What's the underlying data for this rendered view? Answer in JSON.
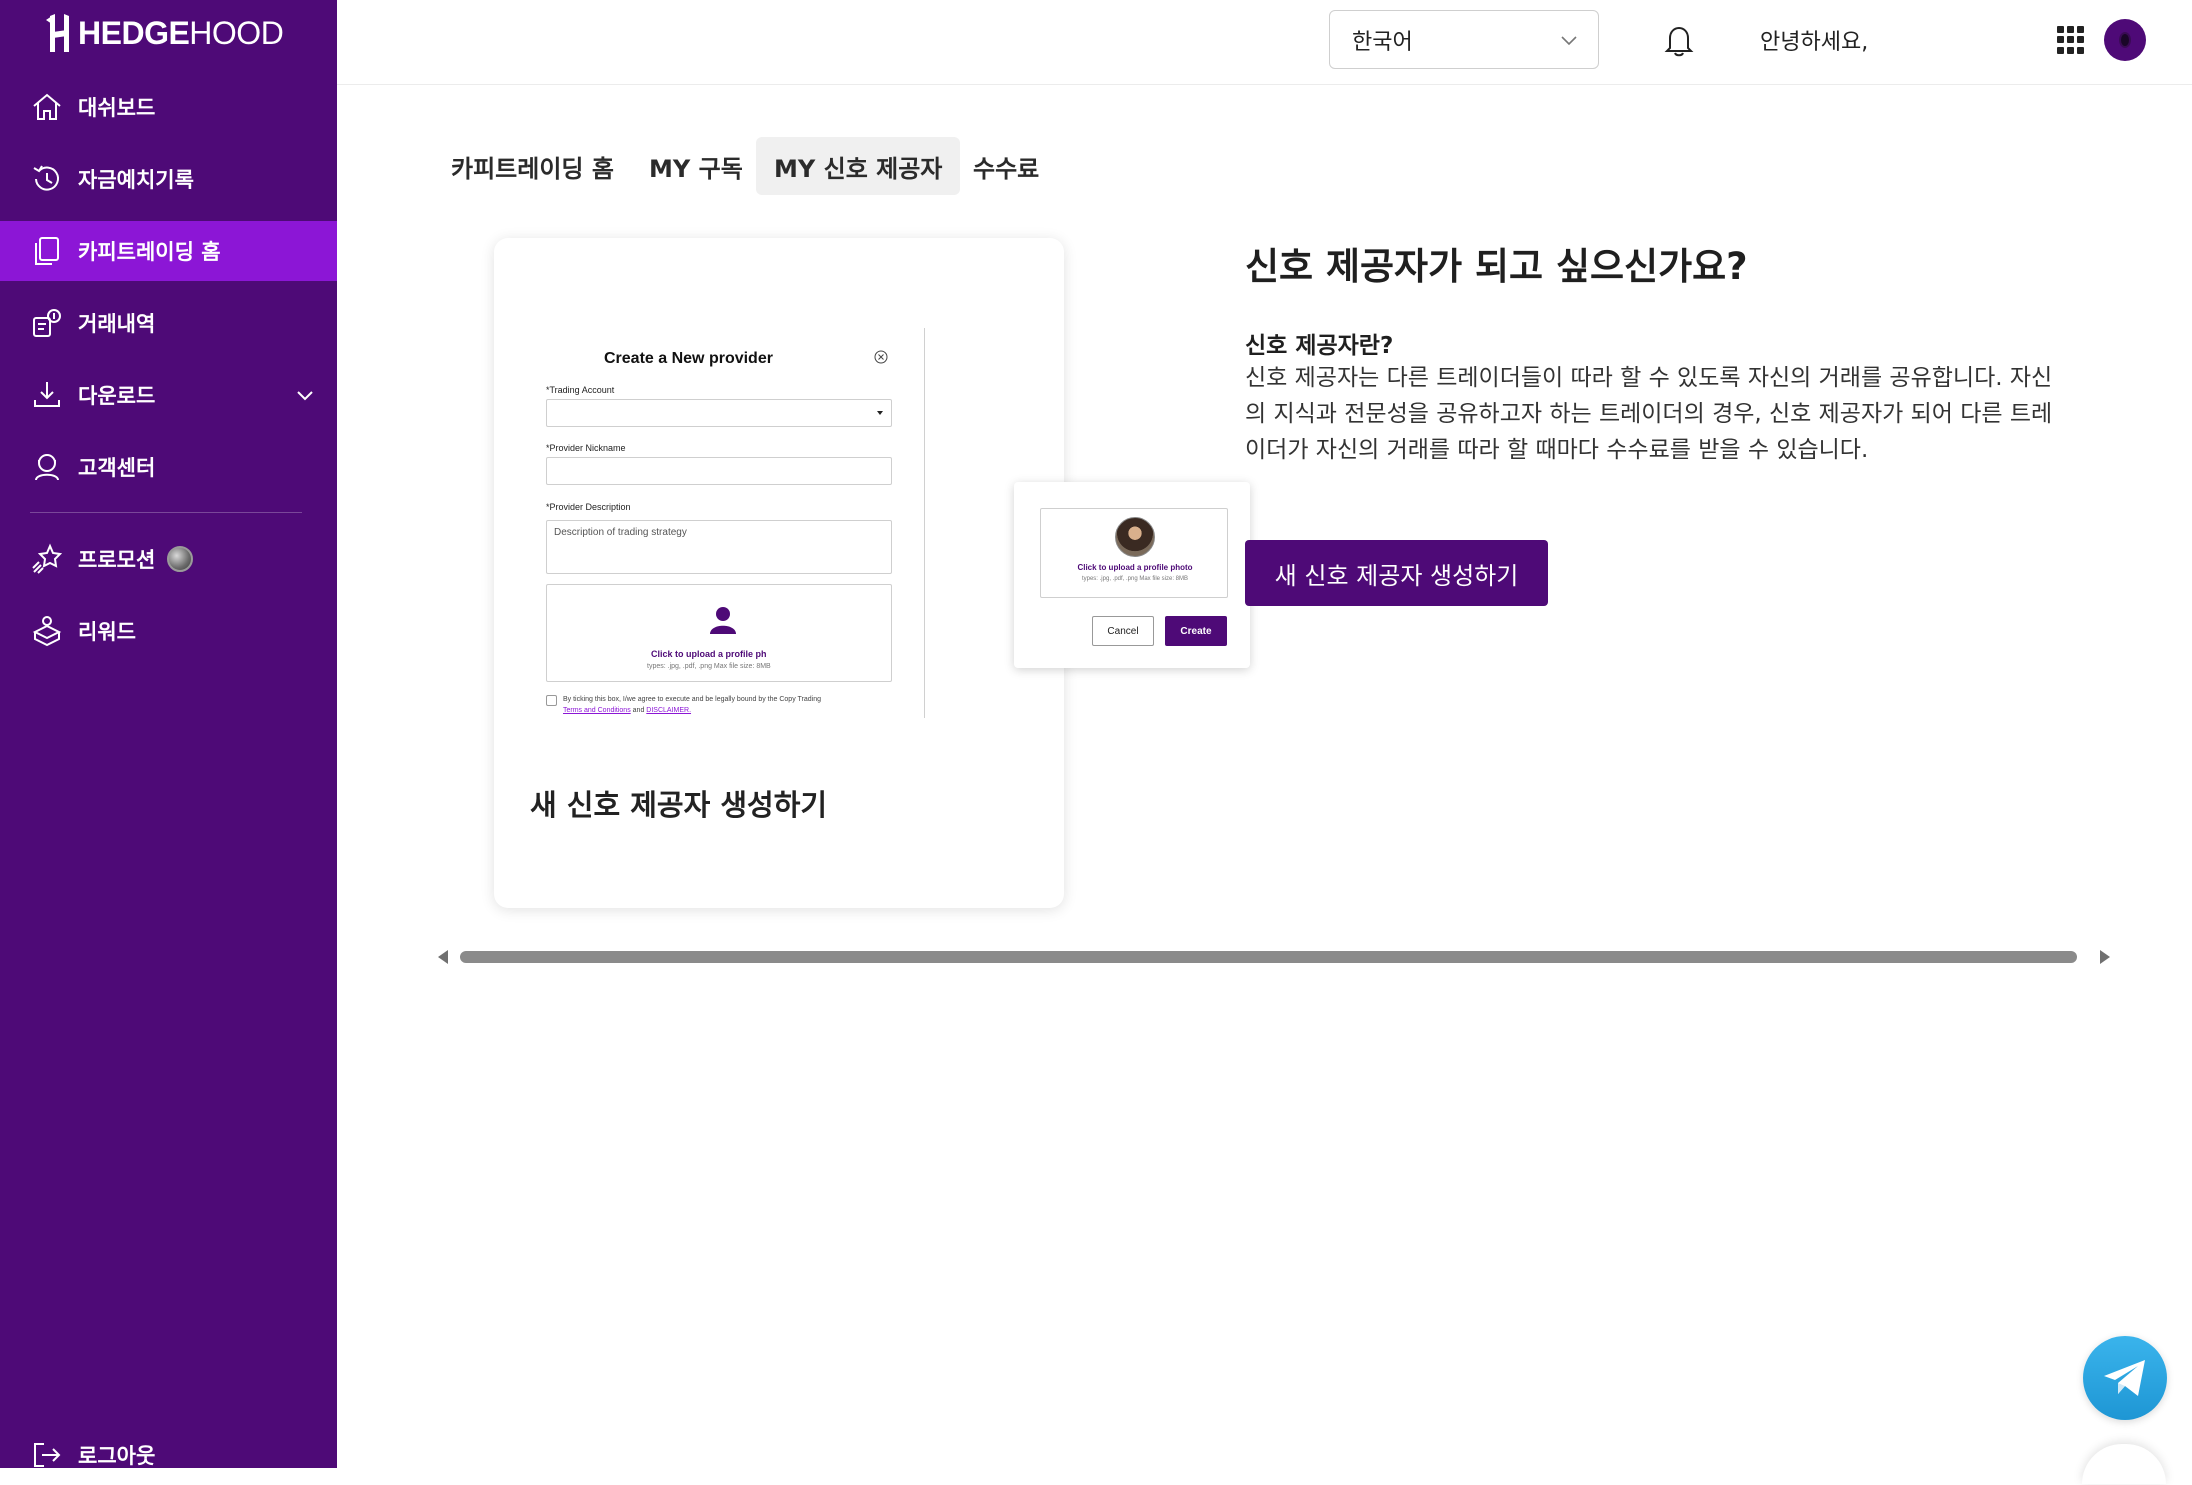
{
  "brand": {
    "logo_strong": "HEDGE",
    "logo_light": "HOOD"
  },
  "sidebar": {
    "items": [
      {
        "label": "대쉬보드",
        "icon": "home-icon"
      },
      {
        "label": "자금예치기록",
        "icon": "history-icon"
      },
      {
        "label": "카피트레이딩 홈",
        "icon": "copy-icon",
        "active": true
      },
      {
        "label": "거래내역",
        "icon": "transactions-icon"
      },
      {
        "label": "다운로드",
        "icon": "download-icon"
      },
      {
        "label": "고객센터",
        "icon": "support-icon"
      },
      {
        "label": "프로모션",
        "icon": "promotion-icon"
      },
      {
        "label": "리워드",
        "icon": "reward-icon"
      }
    ],
    "logout_label": "로그아웃"
  },
  "header": {
    "language": "한국어",
    "greeting": "안녕하세요,"
  },
  "tabs": [
    {
      "label": "카피트레이딩 홈"
    },
    {
      "label": "MY 구독"
    },
    {
      "label": "MY 신호 제공자",
      "active": true
    },
    {
      "label": "수수료"
    }
  ],
  "card": {
    "title": "새 신호 제공자 생성하기",
    "mock": {
      "title": "Create a New provider",
      "trading_account_label": "*Trading Account",
      "nickname_label": "*Provider Nickname",
      "description_label": "*Provider Description",
      "description_placeholder": "Description of trading strategy",
      "upload_text": "Click to upload a profile ph",
      "upload_sub": "types: .jpg, .pdf, .png Max file size: 8MB",
      "agree_text": "By ticking this box, I/we agree to execute and be legally bound by the Copy Trading",
      "terms_link": "Terms and Conditions",
      "and_text": "and",
      "disclaimer_link": "DISCLAIMER.",
      "popup_upload_text": "Click to upload a profile photo",
      "popup_upload_sub": "types: .jpg, .pdf, .png Max file size: 8MB",
      "cancel_label": "Cancel",
      "create_label": "Create"
    }
  },
  "info": {
    "heading": "신호 제공자가 되고 싶으신가요?",
    "subheading": "신호 제공자란?",
    "body": "신호 제공자는 다른 트레이더들이 따라 할 수 있도록 자신의 거래를 공유합니다. 자신의 지식과 전문성을 공유하고자 하는 트레이더의 경우, 신호 제공자가 되어 다른 트레이더가 자신의 거래를 따라 할 때마다 수수료를 받을 수 있습니다.",
    "cta_label": "새 신호 제공자 생성하기"
  },
  "colors": {
    "sidebar": "#4e0a77",
    "active_item": "#8c16d6",
    "accent": "#4e0a77",
    "telegram": "#2aa3e0"
  }
}
